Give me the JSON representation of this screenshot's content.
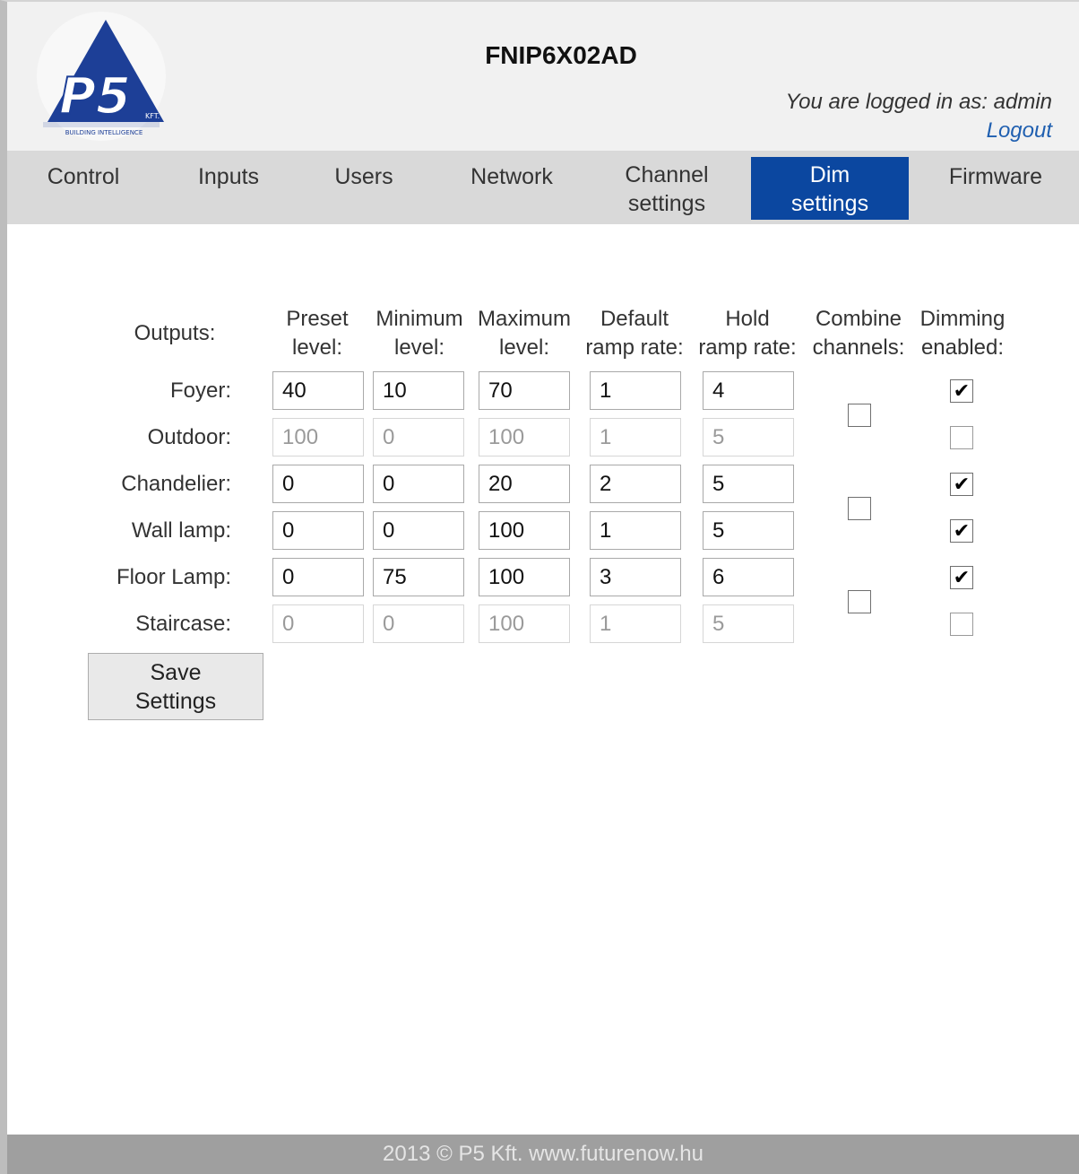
{
  "header": {
    "device_name": "FNIP6X02AD",
    "login_text": "You are logged in as: admin",
    "logout_label": "Logout",
    "logo_letters": "P5",
    "logo_small": "KFT.",
    "logo_tagline": "BUILDING INTELLIGENCE",
    "logo_color": "#1d3f97"
  },
  "nav": {
    "active": "Dim settings",
    "tabs": [
      {
        "label": "Control"
      },
      {
        "label": "Inputs"
      },
      {
        "label": "Users"
      },
      {
        "label": "Network"
      },
      {
        "label": "Channel\nsettings"
      },
      {
        "label": "Dim\nsettings"
      },
      {
        "label": "Firmware"
      }
    ]
  },
  "table": {
    "headers": {
      "outputs": "Outputs:",
      "preset": "Preset\nlevel:",
      "minimum": "Minimum\nlevel:",
      "maximum": "Maximum\nlevel:",
      "default_ramp": "Default\nramp rate:",
      "hold_ramp": "Hold\nramp rate:",
      "combine": "Combine\nchannels:",
      "dimming": "Dimming\nenabled:"
    },
    "rows": [
      {
        "label": "Foyer:",
        "preset": "40",
        "minimum": "10",
        "maximum": "70",
        "default_ramp": "1",
        "hold_ramp": "4",
        "disabled": false,
        "dimming_enabled": true
      },
      {
        "label": "Outdoor:",
        "preset": "100",
        "minimum": "0",
        "maximum": "100",
        "default_ramp": "1",
        "hold_ramp": "5",
        "disabled": true,
        "dimming_enabled": false
      },
      {
        "label": "Chandelier:",
        "preset": "0",
        "minimum": "0",
        "maximum": "20",
        "default_ramp": "2",
        "hold_ramp": "5",
        "disabled": false,
        "dimming_enabled": true
      },
      {
        "label": "Wall lamp:",
        "preset": "0",
        "minimum": "0",
        "maximum": "100",
        "default_ramp": "1",
        "hold_ramp": "5",
        "disabled": false,
        "dimming_enabled": true
      },
      {
        "label": "Floor Lamp:",
        "preset": "0",
        "minimum": "75",
        "maximum": "100",
        "default_ramp": "3",
        "hold_ramp": "6",
        "disabled": false,
        "dimming_enabled": true
      },
      {
        "label": "Staircase:",
        "preset": "0",
        "minimum": "0",
        "maximum": "100",
        "default_ramp": "1",
        "hold_ramp": "5",
        "disabled": true,
        "dimming_enabled": false
      }
    ],
    "combine_pairs": [
      {
        "channels": "Foyer/Outdoor",
        "checked": false
      },
      {
        "channels": "Chandelier/Wall lamp",
        "checked": false
      },
      {
        "channels": "Floor Lamp/Staircase",
        "checked": false
      }
    ],
    "save_label": "Save\nSettings"
  },
  "footer": {
    "text": "2013 © P5 Kft.  www.futurenow.hu"
  }
}
